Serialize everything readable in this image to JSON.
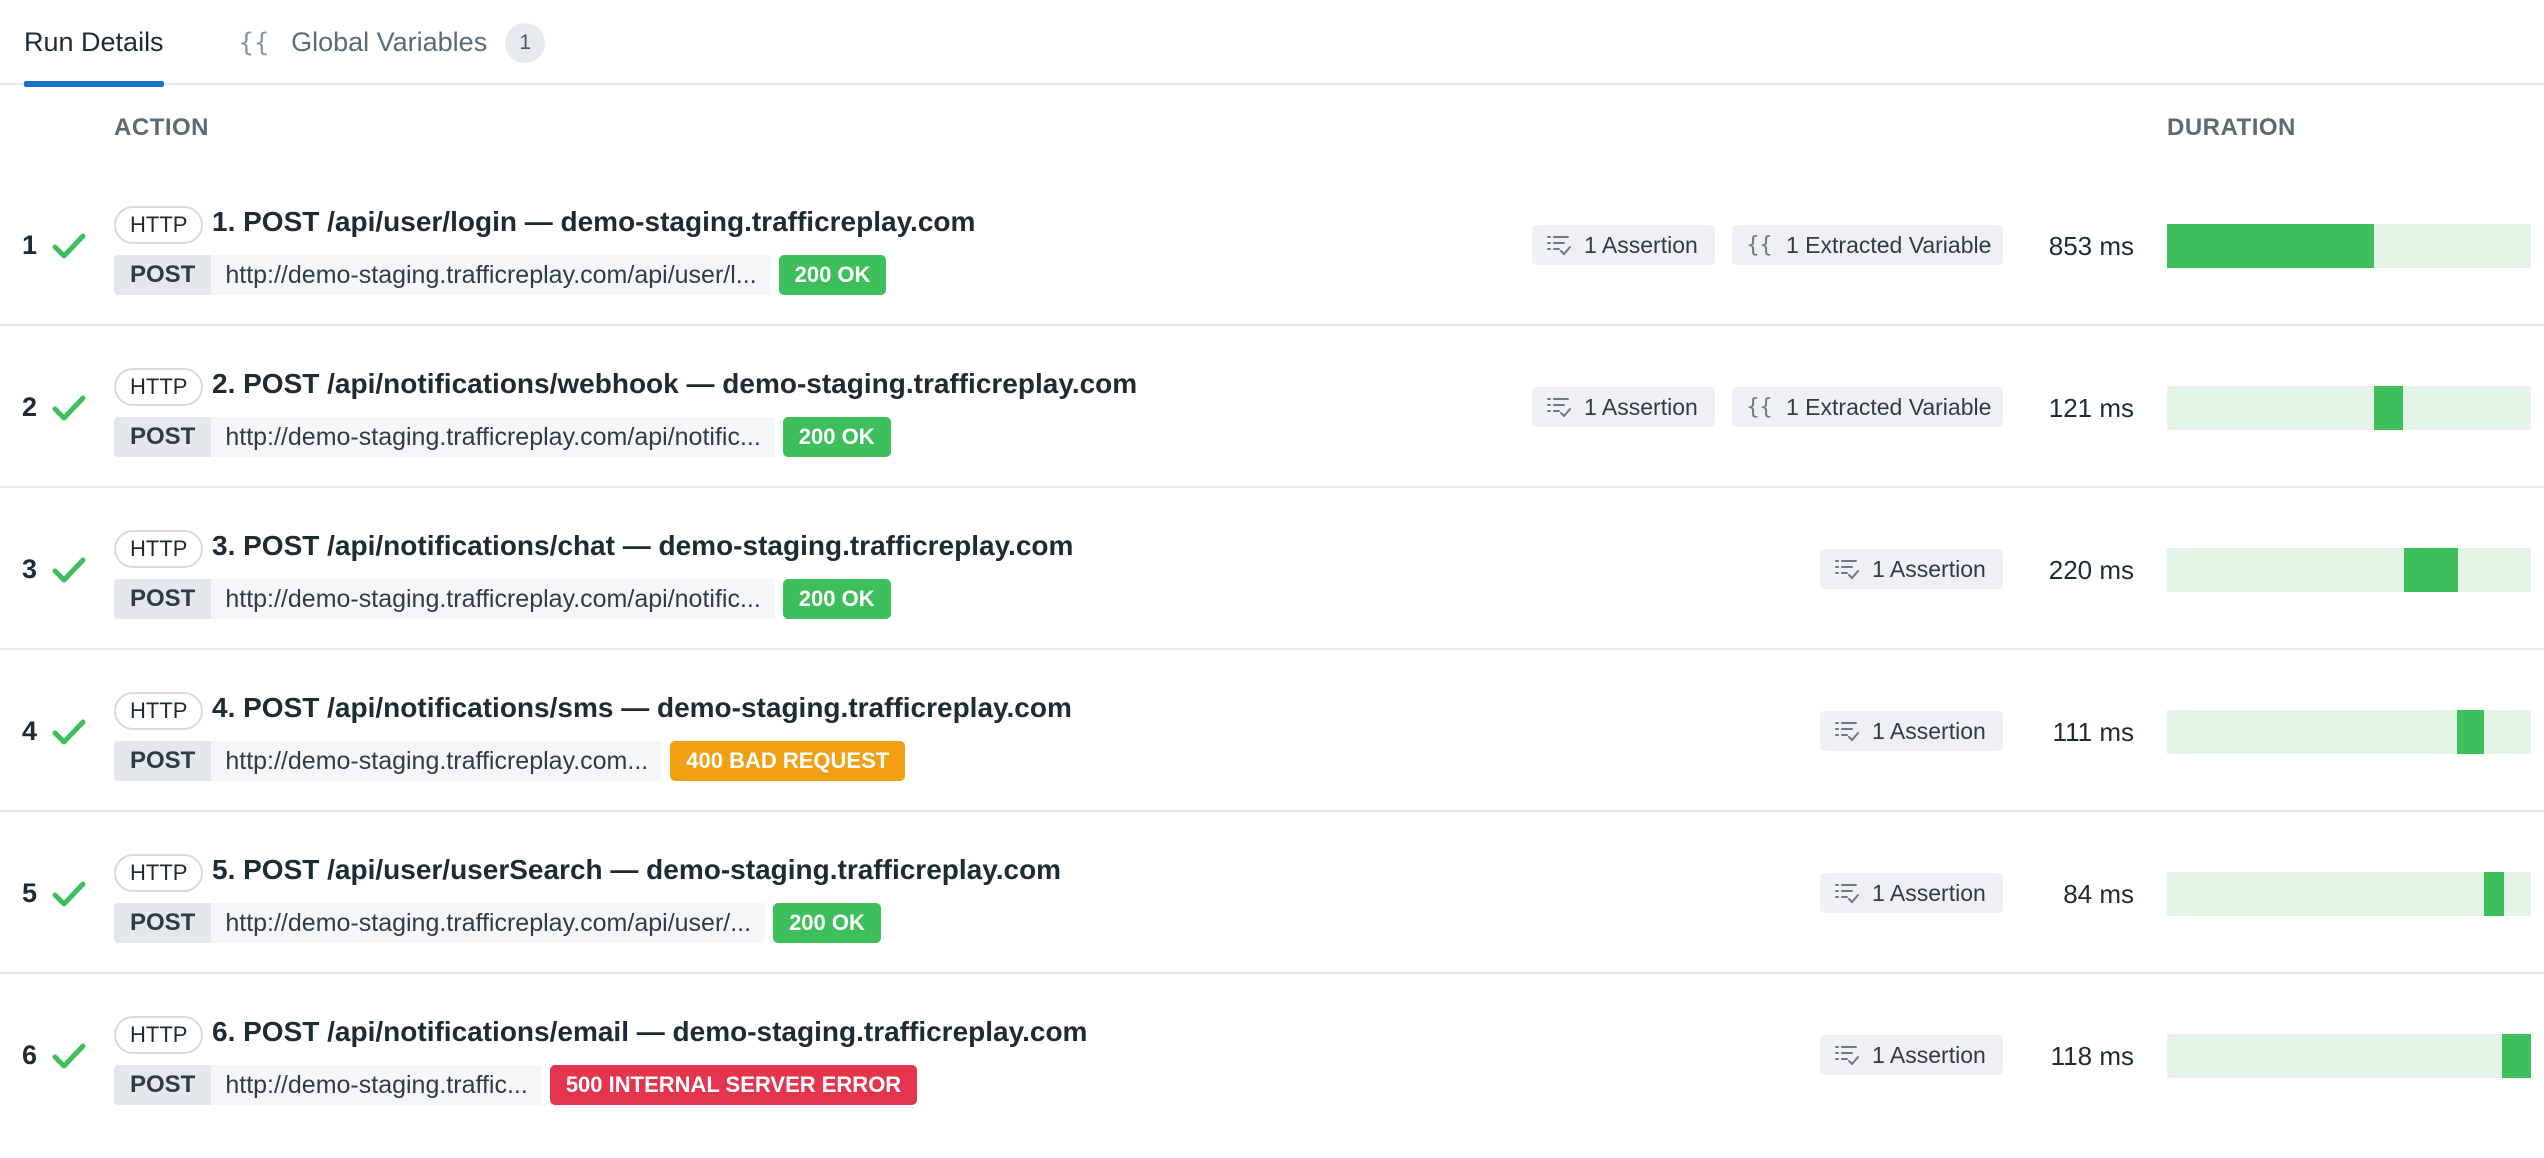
{
  "tabs": {
    "run_details": "Run Details",
    "global_variables": "Global Variables",
    "global_variables_icon": "{{",
    "global_variables_count": "1"
  },
  "columns": {
    "action": "ACTION",
    "duration": "DURATION"
  },
  "colors": {
    "accent": "#1a73c8",
    "success": "#3dbf5c",
    "warning": "#f2a013",
    "error": "#e3354e",
    "bar_track": "#e4f5e7"
  },
  "steps": [
    {
      "index": "1",
      "icon": "check-icon",
      "type_tag": "HTTP",
      "title": "1. POST /api/user/login — demo-staging.trafficreplay.com",
      "method": "POST",
      "url": "http://demo-staging.trafficreplay.com/api/user/l...",
      "status": "200 OK",
      "status_kind": "success",
      "assertions": "1 Assertion",
      "extracted": "1 Extracted Variable",
      "extracted_icon": "{{",
      "duration": "853 ms",
      "bar": {
        "start": 0.0,
        "length": 0.57
      }
    },
    {
      "index": "2",
      "icon": "check-icon",
      "type_tag": "HTTP",
      "title": "2. POST /api/notifications/webhook — demo-staging.trafficreplay.com",
      "method": "POST",
      "url": "http://demo-staging.trafficreplay.com/api/notific...",
      "status": "200 OK",
      "status_kind": "success",
      "assertions": "1 Assertion",
      "extracted": "1 Extracted Variable",
      "extracted_icon": "{{",
      "duration": "121 ms",
      "bar": {
        "start": 0.57,
        "length": 0.081
      }
    },
    {
      "index": "3",
      "icon": "check-icon",
      "type_tag": "HTTP",
      "title": "3. POST /api/notifications/chat — demo-staging.trafficreplay.com",
      "method": "POST",
      "url": "http://demo-staging.trafficreplay.com/api/notific...",
      "status": "200 OK",
      "status_kind": "success",
      "assertions": "1 Assertion",
      "duration": "220 ms",
      "bar": {
        "start": 0.651,
        "length": 0.147
      }
    },
    {
      "index": "4",
      "icon": "check-icon",
      "type_tag": "HTTP",
      "title": "4. POST /api/notifications/sms — demo-staging.trafficreplay.com",
      "method": "POST",
      "url": "http://demo-staging.trafficreplay.com...",
      "status": "400 BAD REQUEST",
      "status_kind": "warning",
      "assertions": "1 Assertion",
      "duration": "111 ms",
      "bar": {
        "start": 0.798,
        "length": 0.074
      }
    },
    {
      "index": "5",
      "icon": "check-icon",
      "type_tag": "HTTP",
      "title": "5. POST /api/user/userSearch — demo-staging.trafficreplay.com",
      "method": "POST",
      "url": "http://demo-staging.trafficreplay.com/api/user/...",
      "status": "200 OK",
      "status_kind": "success",
      "assertions": "1 Assertion",
      "duration": "84 ms",
      "bar": {
        "start": 0.872,
        "length": 0.056
      }
    },
    {
      "index": "6",
      "icon": "check-icon",
      "type_tag": "HTTP",
      "title": "6. POST /api/notifications/email — demo-staging.trafficreplay.com",
      "method": "POST",
      "url": "http://demo-staging.traffic...",
      "status": "500 INTERNAL SERVER ERROR",
      "status_kind": "error",
      "assertions": "1 Assertion",
      "duration": "118 ms",
      "bar": {
        "start": 0.928,
        "length": 0.079
      }
    }
  ]
}
